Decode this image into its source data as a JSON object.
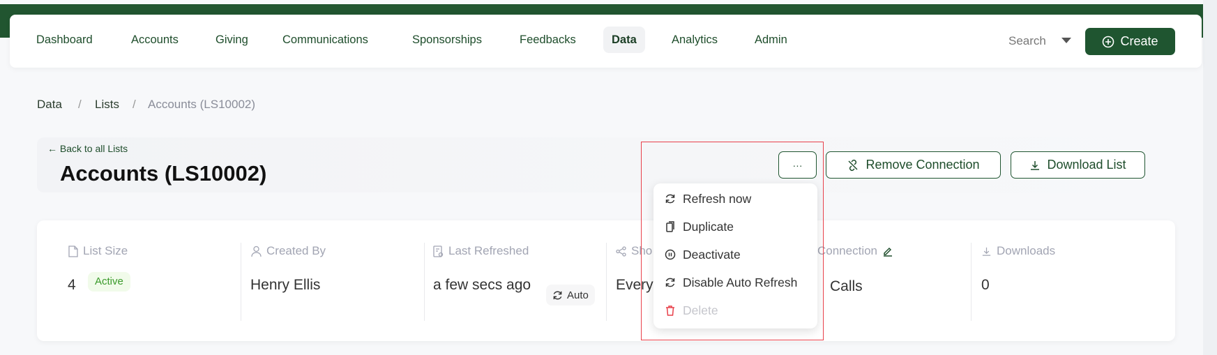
{
  "nav": {
    "items": [
      "Dashboard",
      "Accounts",
      "Giving",
      "Communications",
      "Sponsorships",
      "Feedbacks",
      "Data",
      "Analytics",
      "Admin"
    ],
    "active": "Data",
    "search_label": "Search",
    "create_label": "Create"
  },
  "breadcrumb": [
    "Data",
    "Lists",
    "Accounts (LS10002)"
  ],
  "header": {
    "back_label": "Back to all Lists",
    "title": "Accounts (LS10002)",
    "more_label": "···",
    "remove_connection_label": "Remove Connection",
    "download_list_label": "Download List"
  },
  "stats": {
    "list_size": {
      "label": "List Size",
      "value": "4",
      "status": "Active"
    },
    "created_by": {
      "label": "Created By",
      "value": "Henry Ellis"
    },
    "last_refreshed": {
      "label": "Last Refreshed",
      "value": "a few secs ago",
      "auto_label": "Auto"
    },
    "col4": {
      "label": "Sho",
      "value": "Every"
    },
    "connection": {
      "label": "Connection",
      "value": "Calls"
    },
    "downloads": {
      "label": "Downloads",
      "value": "0"
    }
  },
  "menu": {
    "items": [
      {
        "label": "Refresh now",
        "icon": "refresh-icon"
      },
      {
        "label": "Duplicate",
        "icon": "copy-icon"
      },
      {
        "label": "Deactivate",
        "icon": "pause-icon"
      },
      {
        "label": "Disable Auto Refresh",
        "icon": "refresh-icon"
      },
      {
        "label": "Delete",
        "icon": "trash-icon",
        "disabled": true
      }
    ]
  },
  "colors": {
    "brand": "#1f5530",
    "danger": "#e8404a",
    "active_badge": "#3a9a2a"
  }
}
